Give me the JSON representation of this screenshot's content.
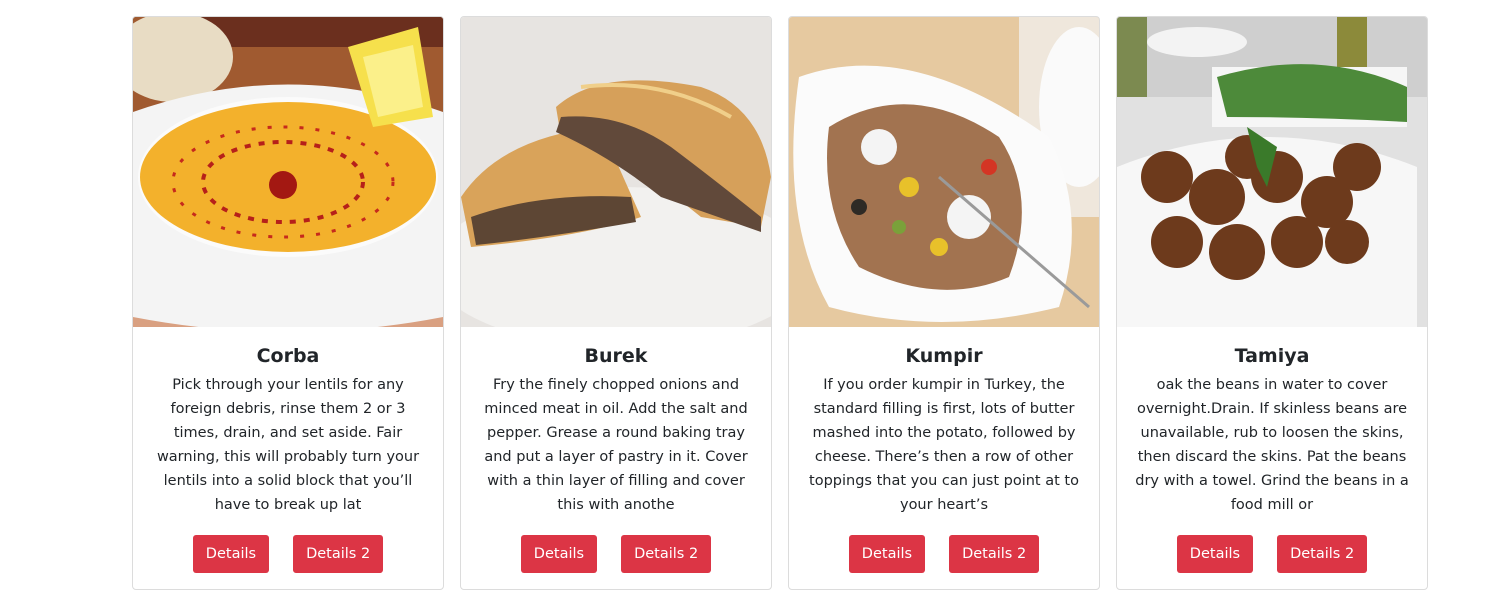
{
  "cards": [
    {
      "title": "Corba",
      "text": "Pick through your lentils for any foreign debris, rinse them 2 or 3 times, drain, and set aside. Fair warning, this will probably turn your lentils into a solid block that you’ll have to break up lat",
      "details_label": "Details",
      "details2_label": "Details 2"
    },
    {
      "title": "Burek",
      "text": "Fry the finely chopped onions and minced meat in oil. Add the salt and pepper. Grease a round baking tray and put a layer of pastry in it. Cover with a thin layer of filling and cover this with anothe",
      "details_label": "Details",
      "details2_label": "Details 2"
    },
    {
      "title": "Kumpir",
      "text": "If you order kumpir in Turkey, the standard filling is first, lots of butter mashed into the potato, followed by cheese. There’s then a row of other toppings that you can just point at to your heart’s",
      "details_label": "Details",
      "details2_label": "Details 2"
    },
    {
      "title": "Tamiya",
      "text": "oak the beans in water to cover overnight.Drain. If skinless beans are unavailable, rub to loosen the skins, then discard the skins. Pat the beans dry with a towel. Grind the beans in a food mill or",
      "details_label": "Details",
      "details2_label": "Details 2"
    }
  ],
  "colors": {
    "button_bg": "#dc3545",
    "button_text": "#ffffff",
    "card_border": "#dcdcdc"
  }
}
